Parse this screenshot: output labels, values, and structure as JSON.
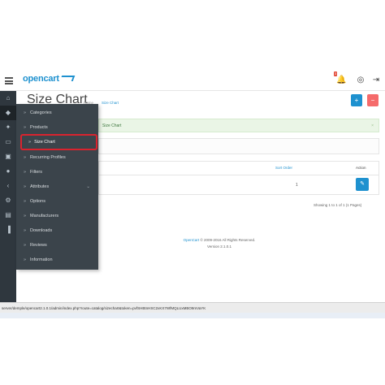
{
  "header": {
    "logo": "opencart",
    "notification_count": "3",
    "icons": [
      "menu-icon",
      "bell-icon",
      "help-icon",
      "logout-icon"
    ]
  },
  "sidebar_icons": [
    "home-icon",
    "tag-icon",
    "puzzle-icon",
    "desktop-icon",
    "cart-icon",
    "user-icon",
    "share-icon",
    "cog-icon",
    "report-icon",
    "chart-icon"
  ],
  "catalog_menu": {
    "items": [
      {
        "label": "Categories"
      },
      {
        "label": "Products"
      },
      {
        "label": "Size Chart"
      },
      {
        "label": "Recurring Profiles"
      },
      {
        "label": "Filters"
      },
      {
        "label": "Attributes"
      },
      {
        "label": "Options"
      },
      {
        "label": "Manufacturers"
      },
      {
        "label": "Downloads"
      },
      {
        "label": "Reviews"
      },
      {
        "label": "Information"
      }
    ],
    "highlighted": "Size Chart"
  },
  "page": {
    "title": "Size Chart",
    "breadcrumb": [
      "Home",
      "Size Chart"
    ],
    "alert_text": "Size Chart",
    "add_button": "+",
    "delete_button": "−"
  },
  "table": {
    "columns": [
      "Sort Order",
      "Action"
    ],
    "rows": [
      {
        "sort_order": "1",
        "action": "edit"
      }
    ],
    "showing": "Showing 1 to 1 of 1 (1 Pages)"
  },
  "footer": {
    "link": "OpenCart",
    "copyright": "© 2009-2016 All Rights Reserved.",
    "version": "Version 2.1.0.1"
  },
  "status_url": "server/demple/opencart2.1.0.1/admin/index.php?route=catalog/sizechart&token=pvfSHBtnHSC2xKX7WfMQLUxMBO9mVaYK"
}
